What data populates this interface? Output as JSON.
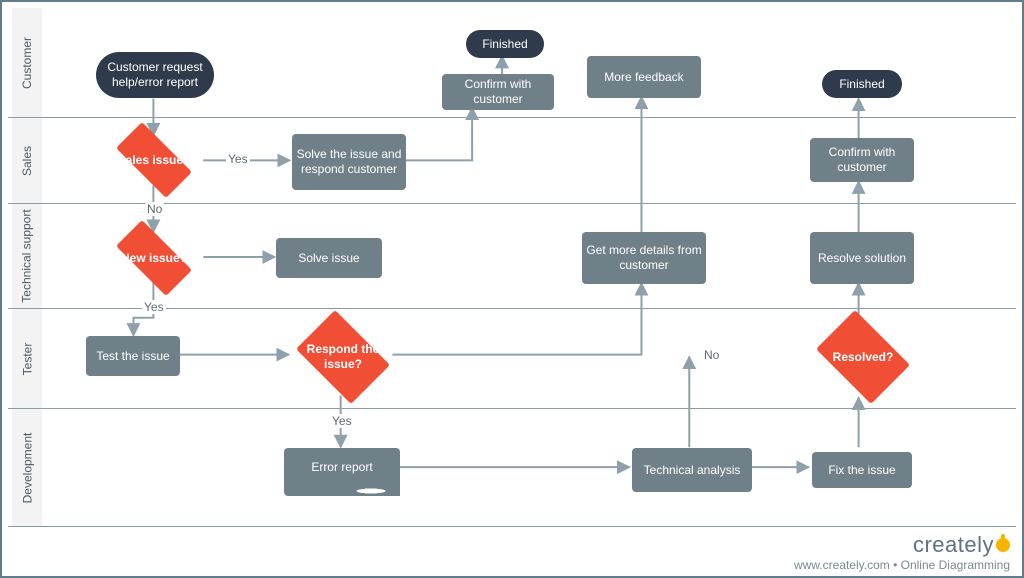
{
  "lanes": {
    "customer": "Customer",
    "sales": "Sales",
    "support": "Technical support",
    "tester": "Tester",
    "dev": "Development"
  },
  "nodes": {
    "start": "Customer request help/error report",
    "decision_sales": "Sales issue?",
    "solve_respond": "Solve the issue and respond customer",
    "confirm1": "Confirm with customer",
    "finished1": "Finished",
    "more_feedback": "More feedback",
    "decision_new": "New issue?",
    "solve_issue": "Solve issue",
    "get_details": "Get more details from customer",
    "test_issue": "Test the issue",
    "decision_respond": "Respond the issue?",
    "resolved": "Resolved?",
    "resolve_solution": "Resolve solution",
    "confirm2": "Confirm with customer",
    "finished2": "Finished",
    "error_report": "Error report",
    "tech_analysis": "Technical analysis",
    "fix_issue": "Fix the issue"
  },
  "edge_labels": {
    "sales_yes": "Yes",
    "sales_no": "No",
    "new_yes": "Yes",
    "respond_yes": "Yes",
    "respond_no": "No"
  },
  "footer": {
    "brand": "creately",
    "byline": "www.creately.com • Online Diagramming"
  }
}
